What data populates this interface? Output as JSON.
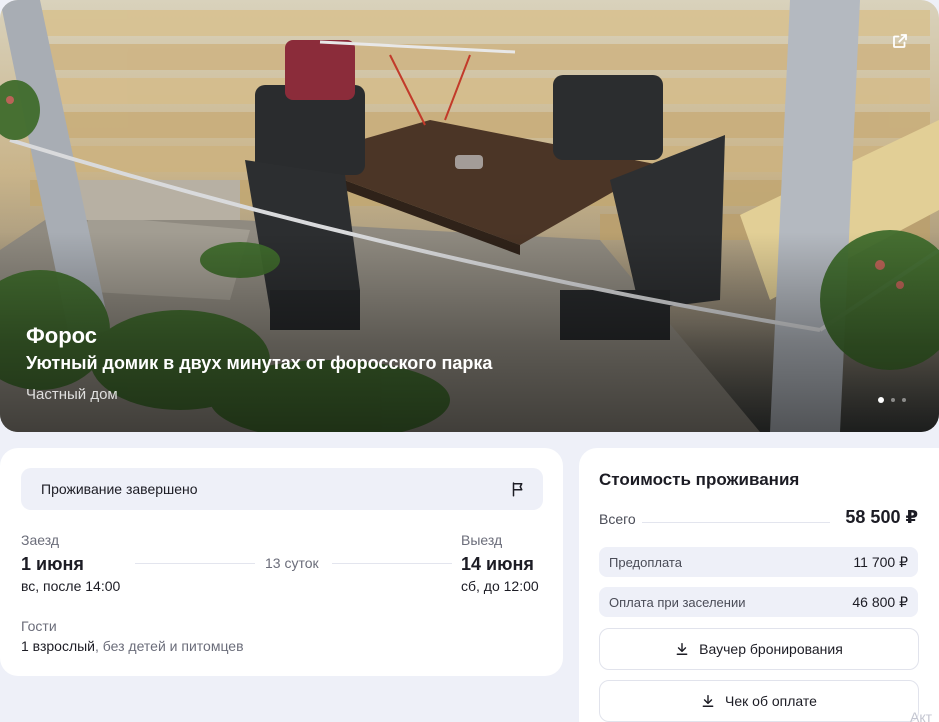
{
  "hero": {
    "city": "Форос",
    "title": "Уютный домик в двух минутах от форосского парка",
    "type": "Частный дом",
    "open_icon": "external-link-icon",
    "slide_indicator": {
      "active": 1,
      "total": 3
    }
  },
  "stay": {
    "status": "Проживание завершено",
    "status_icon": "flag-icon",
    "checkin": {
      "label": "Заезд",
      "date": "1 июня",
      "detail": "вс, после 14:00"
    },
    "nights": "13 суток",
    "checkout": {
      "label": "Выезд",
      "date": "14 июня",
      "detail": "сб, до 12:00"
    },
    "guests": {
      "label": "Гости",
      "adults": "1 взрослый",
      "extra": ", без детей и питомцев"
    }
  },
  "cost": {
    "title": "Стоимость проживания",
    "total_label": "Всего",
    "total_value": "58 500 ₽",
    "rows": [
      {
        "label": "Предоплата",
        "value": "11 700 ₽"
      },
      {
        "label": "Оплата при заселении",
        "value": "46 800 ₽"
      }
    ],
    "voucher_button": "Ваучер бронирования",
    "receipt_button": "Чек об оплате",
    "download_icon": "download-icon"
  },
  "footer": {
    "partial_label": "Акт"
  },
  "colors": {
    "page_bg": "#eef0f8",
    "card_bg": "#ffffff",
    "accent_bg": "#eef0f8",
    "text": "#1c1c24",
    "muted": "#6b6d7a"
  }
}
